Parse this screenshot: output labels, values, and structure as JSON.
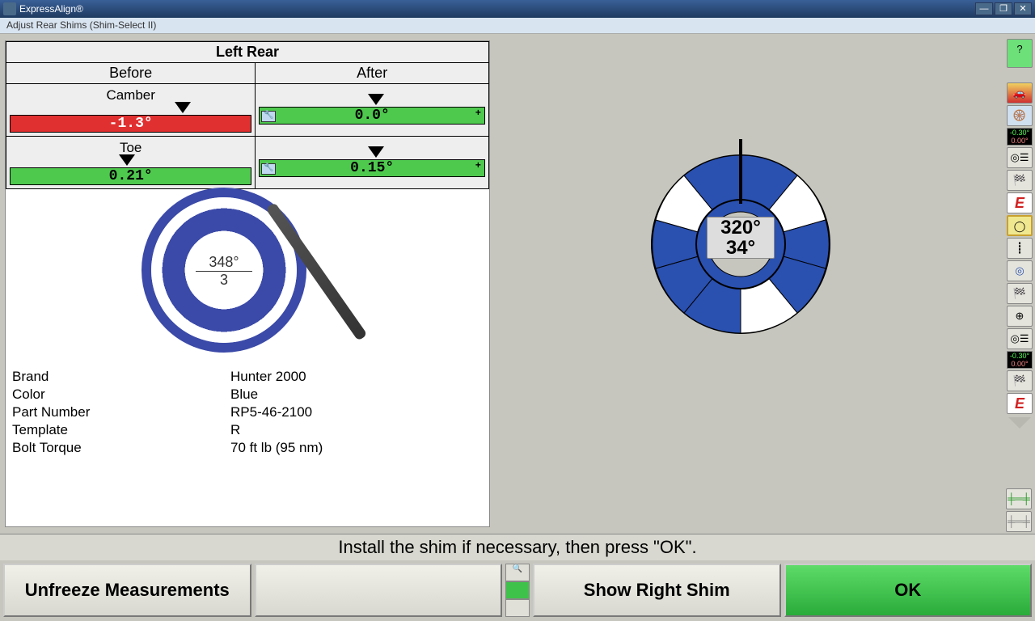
{
  "app": {
    "title": "ExpressAlign®",
    "subtitle": "Adjust Rear Shims   (Shim-Select II)"
  },
  "table": {
    "header": "Left Rear",
    "col_before": "Before",
    "col_after": "After",
    "row_camber": "Camber",
    "row_toe": "Toe",
    "camber_before": "-1.3°",
    "camber_after": "0.0°",
    "toe_before": "0.21°",
    "toe_after": "0.15°"
  },
  "shim_left": {
    "angle": "348°",
    "number": "3"
  },
  "details": {
    "brand_label": "Brand",
    "brand_value": "Hunter 2000",
    "color_label": "Color",
    "color_value": "Blue",
    "part_label": "Part Number",
    "part_value": "RP5-46-2100",
    "template_label": "Template",
    "template_value": "R",
    "torque_label": "Bolt Torque",
    "torque_value": "70 ft lb (95 nm)"
  },
  "dial": {
    "angle": "320°",
    "number": "34°"
  },
  "instruction": "Install the shim if necessary, then press \"OK\".",
  "buttons": {
    "unfreeze": "Unfreeze Measurements",
    "show_right": "Show Right Shim",
    "ok": "OK"
  },
  "toolbar_readout": {
    "top_g": "-0.30°",
    "top_r": "0.00°",
    "bot_g": "-0.30°",
    "bot_r": "0.00°"
  }
}
